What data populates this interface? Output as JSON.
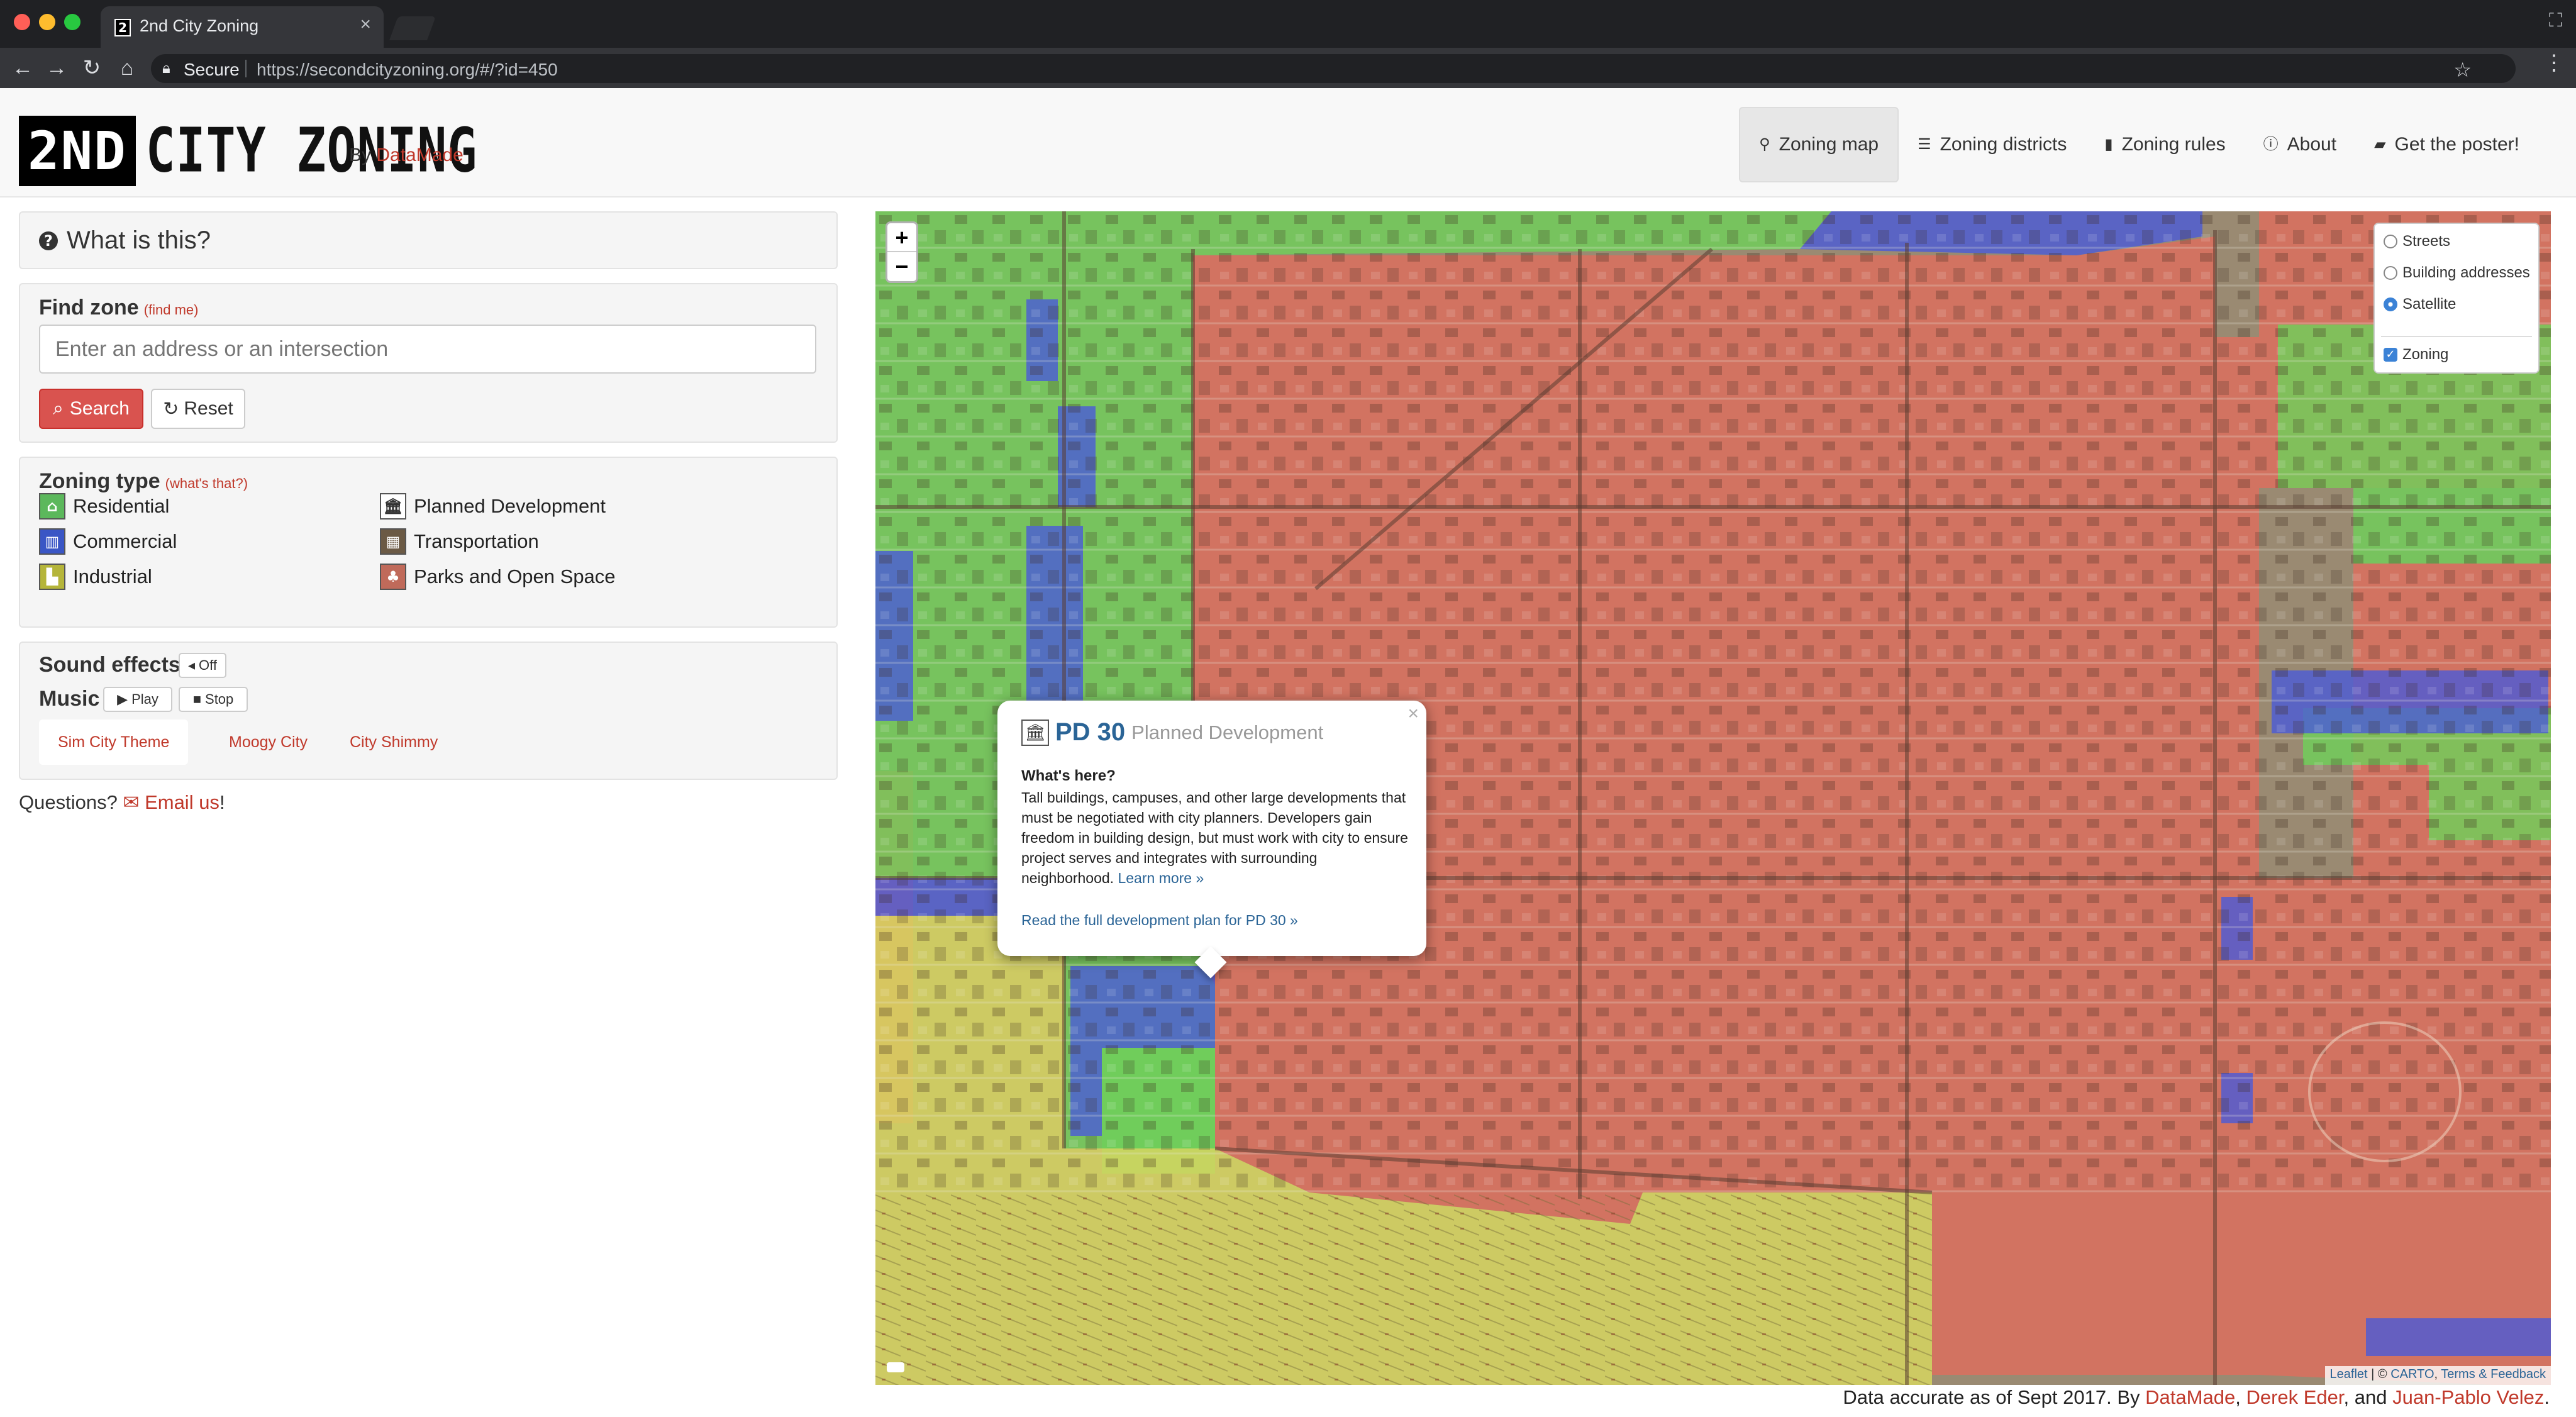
{
  "browser": {
    "tab_title": "2nd City Zoning",
    "tab_favicon": "2",
    "secure_label": "Secure",
    "url": "https://secondcityzoning.org/#/?id=450",
    "icons": [
      "back-icon",
      "forward-icon",
      "reload-icon",
      "home-icon",
      "lock-icon",
      "star-icon",
      "menu-icon",
      "incognito-icon"
    ]
  },
  "header": {
    "logo_text": "2ND CITY ZONING",
    "logo_box": "2ND",
    "logo_rest": "CITY ZONING",
    "by_prefix": "By",
    "by_link": "DataMade",
    "nav": [
      {
        "label": "Zoning map",
        "icon": "map-marker-icon"
      },
      {
        "label": "Zoning districts",
        "icon": "list-icon"
      },
      {
        "label": "Zoning rules",
        "icon": "book-icon"
      },
      {
        "label": "About",
        "icon": "info-icon"
      },
      {
        "label": "Get the poster!",
        "icon": "image-icon"
      }
    ]
  },
  "sidebar": {
    "what_title": "What is this?",
    "find_title": "Find zone",
    "find_me": "(find me)",
    "address_placeholder": "Enter an address or an intersection",
    "search_label": "Search",
    "reset_label": "Reset",
    "zoning_title": "Zoning type",
    "whats_that": "(what's that?)",
    "zones": [
      {
        "label": "Residential",
        "color": "#5cb85c",
        "icon": "residential-icon"
      },
      {
        "label": "Commercial",
        "color": "#3a56c5",
        "icon": "commercial-icon"
      },
      {
        "label": "Industrial",
        "color": "#b5b53a",
        "icon": "industrial-icon"
      },
      {
        "label": "Planned Development",
        "color": "#ffffff",
        "icon": "planned-development-icon"
      },
      {
        "label": "Transportation",
        "color": "#6b5a45",
        "icon": "transportation-icon"
      },
      {
        "label": "Parks and Open Space",
        "color": "#c06a5a",
        "icon": "parks-icon"
      }
    ],
    "sound_title": "Sound effects",
    "sound_off": "Off",
    "music_title": "Music",
    "play_label": "Play",
    "stop_label": "Stop",
    "themes": [
      "Sim City Theme",
      "Moogy City",
      "City Shimmy"
    ],
    "questions": "Questions?",
    "email_label": "Email us",
    "exclaim": "!"
  },
  "map": {
    "zoom_in": "+",
    "zoom_out": "−",
    "layers": [
      {
        "label": "Streets",
        "type": "radio",
        "checked": false
      },
      {
        "label": "Building addresses",
        "type": "radio",
        "checked": false
      },
      {
        "label": "Satellite",
        "type": "radio",
        "checked": true
      },
      {
        "label": "Zoning",
        "type": "checkbox",
        "checked": true
      }
    ],
    "popup": {
      "name": "PD 30",
      "type": "Planned Development",
      "question": "What's here?",
      "description": "Tall buildings, campuses, and other large developments that must be negotiated with city planners. Developers gain freedom in building design, but must work with city to ensure project serves and integrates with surrounding neighborhood.",
      "learn_more": "Learn more »",
      "plan_link": "Read the full development plan for PD 30 »"
    },
    "attribution": {
      "leaflet": "Leaflet",
      "sep": " | © ",
      "carto": "CARTO",
      "comma": ", ",
      "terms": "Terms & Feedback"
    },
    "colors": {
      "planned": "#d9705f",
      "residential": "#6fd05a",
      "commercial": "#4a5ad8",
      "industrial": "#d8d860"
    }
  },
  "footer": {
    "prefix": "Data accurate as of Sept 2017. By",
    "a1": "DataMade",
    "sep1": ",",
    "a2": "Derek Eder",
    "sep2": ", and",
    "a3": "Juan-Pablo Velez",
    "end": "."
  }
}
